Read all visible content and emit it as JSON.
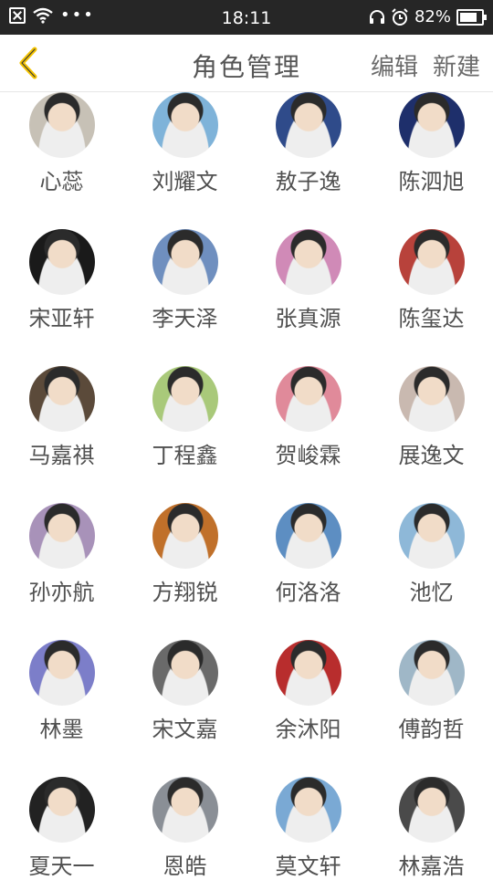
{
  "status_bar": {
    "time": "18:11",
    "battery": "82%"
  },
  "nav": {
    "title": "角色管理",
    "edit_label": "编辑",
    "new_label": "新建",
    "accent": "#f5c400"
  },
  "roles": [
    {
      "name": "心蕊",
      "color": "#c7c1b6"
    },
    {
      "name": "刘耀文",
      "color": "#7fb3d9"
    },
    {
      "name": "敖子逸",
      "color": "#2f4b8a"
    },
    {
      "name": "陈泗旭",
      "color": "#1e2f6b"
    },
    {
      "name": "宋亚轩",
      "color": "#1a1a1a"
    },
    {
      "name": "李天泽",
      "color": "#6f8fbf"
    },
    {
      "name": "张真源",
      "color": "#d08ab7"
    },
    {
      "name": "陈玺达",
      "color": "#b8423b"
    },
    {
      "name": "马嘉祺",
      "color": "#5b4a3a"
    },
    {
      "name": "丁程鑫",
      "color": "#a9c97a"
    },
    {
      "name": "贺峻霖",
      "color": "#e08a9a"
    },
    {
      "name": "展逸文",
      "color": "#c9b9b0"
    },
    {
      "name": "孙亦航",
      "color": "#a892b9"
    },
    {
      "name": "方翔锐",
      "color": "#c0702a"
    },
    {
      "name": "何洛洛",
      "color": "#5d8ec2"
    },
    {
      "name": "池忆",
      "color": "#8eb8d8"
    },
    {
      "name": "林墨",
      "color": "#7c7ec9"
    },
    {
      "name": "宋文嘉",
      "color": "#6a6a6a"
    },
    {
      "name": "余沐阳",
      "color": "#b82d2d"
    },
    {
      "name": "傅韵哲",
      "color": "#9fb7c7"
    },
    {
      "name": "夏天一",
      "color": "#222222"
    },
    {
      "name": "恩皓",
      "color": "#8a8f96"
    },
    {
      "name": "莫文轩",
      "color": "#7aa9d4"
    },
    {
      "name": "林嘉浩",
      "color": "#4a4a4a"
    }
  ]
}
